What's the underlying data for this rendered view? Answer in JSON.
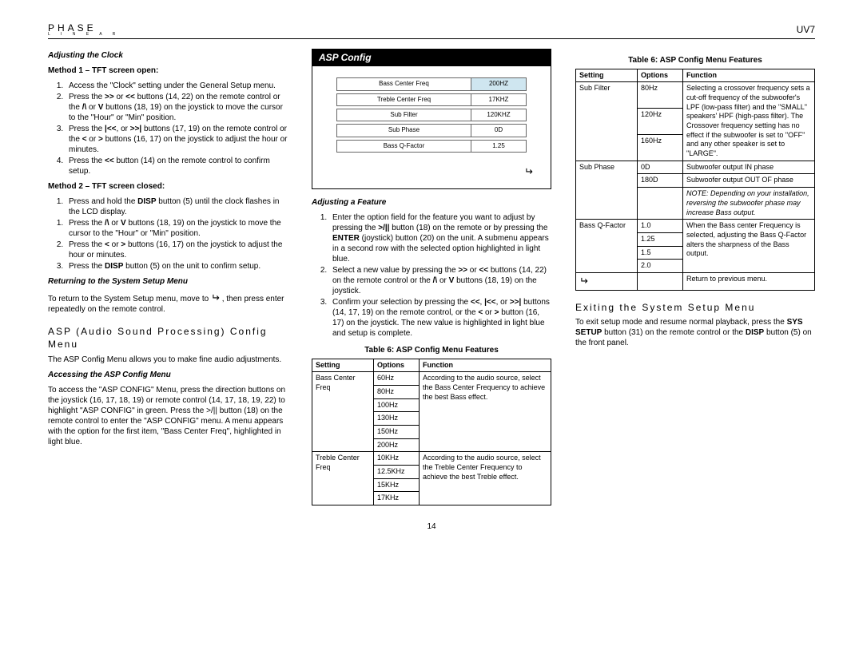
{
  "header": {
    "brand_main": "PHASE",
    "brand_sub": "L I N E A R",
    "model": "UV7"
  },
  "page_number": "14",
  "col1": {
    "h_clock": "Adjusting the Clock",
    "h_m1": "Method 1 – TFT screen open:",
    "m1_steps": [
      "Access the \"Clock\" setting under the General Setup menu.",
      "Press the >> or << buttons (14, 22) on the remote control or the /\\ or V buttons (18, 19) on the joystick to move the cursor to the \"Hour\" or \"Min\" position.",
      "Press the |<<, or >>| buttons (17, 19) on the remote control or the < or > buttons (16, 17) on the joystick to adjust the hour or minutes.",
      "Press the << button (14) on the remote control to confirm setup."
    ],
    "h_m2": "Method 2 – TFT screen closed:",
    "m2_steps": [
      "Press and hold the DISP button (5) until the clock flashes in the LCD display.",
      "Press the /\\ or V buttons (18, 19) on the joystick to move the cursor to the \"Hour\" or \"Min\" position.",
      "Press the < or > buttons (16, 17) on the joystick to adjust the hour or minutes.",
      "Press the DISP button (5) on the unit to confirm setup."
    ],
    "h_return": "Returning to the System Setup Menu",
    "return_text_a": "To return to the System Setup menu, move to ",
    "return_text_b": " , then press enter repeatedly on the remote control.",
    "h_asp": "ASP (Audio Sound Processing) Config Menu",
    "asp_intro": "The ASP Config Menu allows you to make fine audio adjustments.",
    "h_access": "Accessing the ASP Config Menu",
    "access_text": "To access the \"ASP CONFIG\" Menu, press the direction buttons on the joystick (16, 17, 18, 19) or remote control (14, 17, 18, 19, 22) to highlight \"ASP CONFIG\" in green. Press the >/|| button (18) on the remote control to enter the \"ASP CONFIG\" menu. A menu appears with the option for the first item, \"Bass Center Freq\", highlighted in light blue."
  },
  "asp_panel": {
    "title": "ASP Config",
    "rows": [
      {
        "label": "Bass Center Freq",
        "value": "200HZ",
        "hi": true
      },
      {
        "label": "Treble Center Freq",
        "value": "17KHZ",
        "hi": false
      },
      {
        "label": "Sub Filter",
        "value": "120KHZ",
        "hi": false
      },
      {
        "label": "Sub Phase",
        "value": "0D",
        "hi": false
      },
      {
        "label": "Bass Q-Factor",
        "value": "1.25",
        "hi": false
      }
    ]
  },
  "col2": {
    "h_adjust": "Adjusting a Feature",
    "adjust_steps": [
      "Enter the option field for the feature you want to adjust by pressing the >/|| button (18) on the remote or by pressing the ENTER (joystick) button (20) on the unit. A submenu appears in a second row with the selected option highlighted in light blue.",
      "Select a new value by pressing the >> or << buttons (14, 22) on the remote control or the /\\ or V buttons (18, 19) on the joystick.",
      "Confirm your selection by pressing the <<, |<<, or >>| buttons (14, 17, 19) on the remote control, or the < or > button (16, 17) on the joystick. The new value is highlighted in light blue and setup is complete."
    ],
    "table_caption": "Table 6: ASP Config Menu Features",
    "table_headers": {
      "setting": "Setting",
      "options": "Options",
      "function": "Function"
    },
    "t1": [
      {
        "setting": "Bass Center Freq",
        "func": "According to the audio source, select the Bass Center Frequency to achieve the best Bass effect.",
        "opts": [
          "60Hz",
          "80Hz",
          "100Hz",
          "130Hz",
          "150Hz",
          "200Hz"
        ]
      },
      {
        "setting": "Treble Center Freq",
        "func": "According to the audio source, select the Treble Center Frequency to achieve the best Treble effect.",
        "opts": [
          "10KHz",
          "12.5KHz",
          "15KHz",
          "17KHz"
        ]
      }
    ]
  },
  "col3": {
    "table_caption": "Table 6: ASP Config Menu Features",
    "table_headers": {
      "setting": "Setting",
      "options": "Options",
      "function": "Function"
    },
    "t2": [
      {
        "setting": "Sub Filter",
        "func": "Selecting a crossover frequency sets a cut-off frequency of the subwoofer's LPF (low-pass filter) and the \"SMALL\" speakers' HPF (high-pass filter). The Crossover frequency setting has no effect if the subwoofer is set to \"OFF\" and any other speaker is set to \"LARGE\".",
        "opts": [
          "80Hz",
          "120Hz",
          "160Hz"
        ]
      },
      {
        "setting": "Sub Phase",
        "rows": [
          {
            "opt": "0D",
            "func": "Subwoofer output IN phase"
          },
          {
            "opt": "180D",
            "func": "Subwoofer output OUT OF phase"
          },
          {
            "opt": "",
            "func": "NOTE: Depending on your installation, reversing the subwoofer phase may increase Bass output.",
            "note": true
          }
        ]
      },
      {
        "setting": "Bass Q-Factor",
        "func": "When the Bass center Frequency is selected, adjusting the Bass Q-Factor alters the sharpness of the Bass output.",
        "opts": [
          "1.0",
          "1.25",
          "1.5",
          "2.0"
        ]
      },
      {
        "setting_icon": true,
        "func": "Return to previous menu."
      }
    ],
    "h_exit": "Exiting the System Setup Menu",
    "exit_text": "To exit setup mode and resume normal playback, press the SYS SETUP button (31) on the remote control or the DISP button (5) on the front panel."
  }
}
